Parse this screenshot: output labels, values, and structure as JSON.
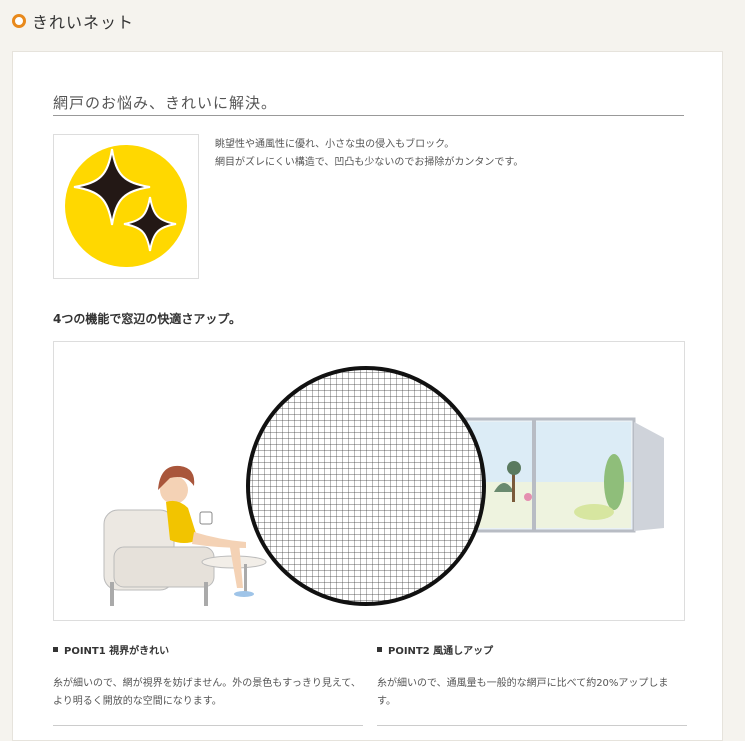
{
  "header": {
    "title": "きれいネット",
    "icon": "ring-icon",
    "accent": "#e8891c"
  },
  "section": {
    "title": "網戸のお悩み、きれいに解決。",
    "intro_lines": [
      "眺望性や通風性に優れ、小さな虫の侵入もブロック。",
      "網目がズレにくい構造で、凹凸も少ないのでお掃除がカンタンです。"
    ],
    "logo_colors": {
      "circle": "#ffd800",
      "star": "#231815"
    }
  },
  "features": {
    "heading": "4つの機能で窓辺の快適さアップ。",
    "points": [
      {
        "title": "POINT1 視界がきれい",
        "text": "糸が細いので、網が視界を妨げません。外の景色もすっきり見えて、より明るく開放的な空間になります。"
      },
      {
        "title": "POINT2 風通しアップ",
        "text": "糸が細いので、通風量も一般的な網戸に比べて約20%アップします。"
      }
    ]
  }
}
